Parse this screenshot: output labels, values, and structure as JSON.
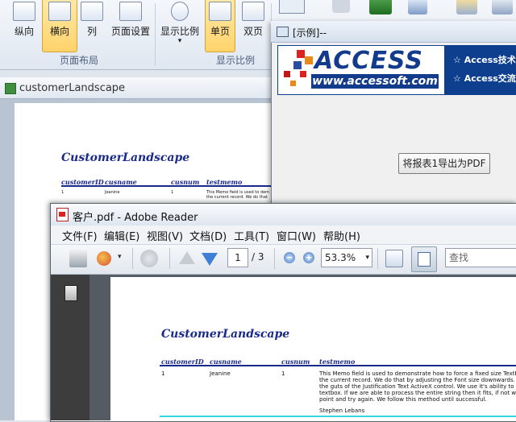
{
  "ribbon": {
    "buttons": [
      {
        "label": "纵向"
      },
      {
        "label": "横向"
      },
      {
        "label": "列"
      },
      {
        "label": "页面设置"
      },
      {
        "label": "显示比例"
      },
      {
        "label": "单页"
      },
      {
        "label": "双页"
      }
    ],
    "groups": [
      "页面布局",
      "显示比例"
    ]
  },
  "access_doc": {
    "title": "customerLandscape",
    "report_title": "CustomerLandscape",
    "columns": [
      "customerID",
      "cusname",
      "cusnum",
      "testmemo"
    ],
    "row": {
      "id": "1",
      "name": "Jeanine",
      "num": "1",
      "memo_lines": [
        "This Memo field is used to dem",
        "the current record. We do that"
      ]
    }
  },
  "example_dialog": {
    "title": "[示例]--",
    "logo_text": "ACCESS",
    "logo_url": "www.accessoft.com",
    "banner_lines": [
      "☆ Access技术",
      "☆ Access交流"
    ],
    "export_button": "将报表1导出为PDF"
  },
  "reader": {
    "title": "客户.pdf - Adobe Reader",
    "menu": [
      "文件(F)",
      "编辑(E)",
      "视图(V)",
      "文档(D)",
      "工具(T)",
      "窗口(W)",
      "帮助(H)"
    ],
    "page_current": "1",
    "page_total": "/ 3",
    "zoom": "53.3%",
    "search_placeholder": "查找",
    "report_title": "CustomerLandscape",
    "columns": [
      "customerID",
      "cusname",
      "cusnum",
      "testmemo"
    ],
    "row": {
      "id": "1",
      "name": "Jeanine",
      "num": "1",
      "memo_lines": [
        "This Memo field is used to demonstrate how to force a fixed size TextBox control to fit all of",
        "the current record. We do that by adjusting the Font size downwards. This is accomplished",
        "the guts of the Justification Text ActiveX control. We use it's ability to parse an print st",
        "textbox. If we are able to process the entire string then it fits, if not we reduce the font",
        "point and try again. We follow this method until successful."
      ],
      "signature": "Stephen Lebans"
    }
  },
  "colors": {
    "report_blue": "#1a2a8a",
    "ribbon_active": "#ffd36b",
    "banner_blue": "#0e3f8e",
    "reader_dark": "#555b63",
    "cyan_rule": "#34d6e0"
  }
}
